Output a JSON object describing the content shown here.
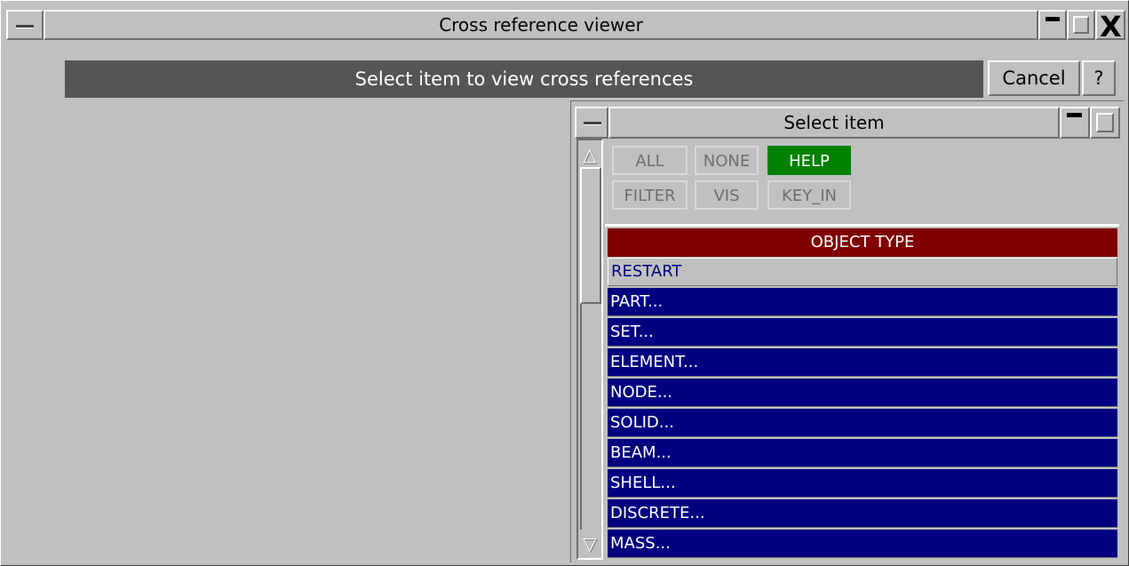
{
  "window": {
    "title": "Cross reference viewer",
    "close_glyph": "X"
  },
  "prompt": {
    "text": "Select item to view cross references",
    "cancel_label": "Cancel",
    "help_label": "?"
  },
  "select_dialog": {
    "title": "Select item",
    "buttons": {
      "all": "ALL",
      "none": "NONE",
      "help": "HELP",
      "filter": "FILTER",
      "vis": "VIS",
      "key_in": "KEY_IN"
    },
    "list_header": "OBJECT TYPE",
    "items": [
      "RESTART",
      "PART...",
      "SET...",
      "ELEMENT...",
      "NODE...",
      "SOLID...",
      "BEAM...",
      "SHELL...",
      "DISCRETE...",
      "MASS..."
    ]
  },
  "colors": {
    "window_bg": "#c0c0c0",
    "prompt_bg": "#555555",
    "help_button": "#008000",
    "list_header": "#800000",
    "list_item": "#000080"
  },
  "icons": {
    "window_menu": "window-menu-icon",
    "minimize": "minimize-icon",
    "maximize": "maximize-icon",
    "close": "close-icon",
    "scroll_up": "scroll-up-icon",
    "scroll_down": "scroll-down-icon"
  }
}
